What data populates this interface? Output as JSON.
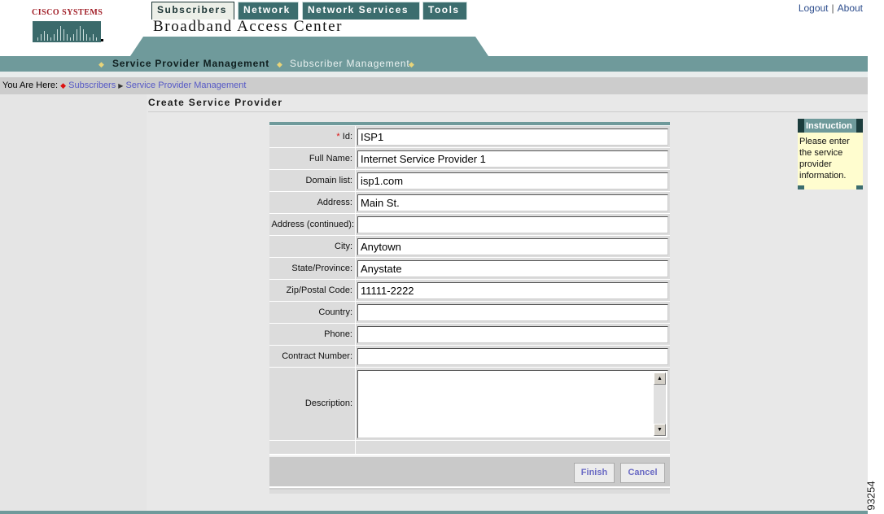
{
  "brand": {
    "logo_text": "Cisco Systems",
    "app_title": "Broadband Access Center"
  },
  "top_links": {
    "logout": "Logout",
    "separator": "|",
    "about": "About"
  },
  "tabs": [
    {
      "label": "Subscribers",
      "active": true
    },
    {
      "label": "Network",
      "active": false
    },
    {
      "label": "Network Services",
      "active": false
    },
    {
      "label": "Tools",
      "active": false
    }
  ],
  "subnav": [
    {
      "label": "Service Provider Management",
      "active": true
    },
    {
      "label": "Subscriber Management",
      "active": false
    }
  ],
  "breadcrumb": {
    "prefix": "You Are Here:",
    "items": [
      "Subscribers",
      "Service Provider Management"
    ]
  },
  "page_title": "Create Service Provider",
  "form": {
    "required_mark": "*",
    "fields": [
      {
        "label": "Id:",
        "value": "ISP1"
      },
      {
        "label": "Full Name:",
        "value": "Internet Service Provider 1"
      },
      {
        "label": "Domain list:",
        "value": "isp1.com"
      },
      {
        "label": "Address:",
        "value": "Main St."
      },
      {
        "label": "Address (continued):",
        "value": ""
      },
      {
        "label": "City:",
        "value": "Anytown"
      },
      {
        "label": "State/Province:",
        "value": "Anystate"
      },
      {
        "label": "Zip/Postal Code:",
        "value": "11111-2222"
      },
      {
        "label": "Country:",
        "value": ""
      },
      {
        "label": "Phone:",
        "value": ""
      },
      {
        "label": "Contract Number:",
        "value": ""
      }
    ],
    "description_label": "Description:",
    "description_value": "",
    "finish_label": "Finish",
    "cancel_label": "Cancel"
  },
  "instruction": {
    "title": "Instruction",
    "text": "Please enter the service provider information."
  },
  "figure_number": "93254",
  "colors": {
    "teal": "#6f9a9b",
    "dark_teal": "#3c6d6e",
    "link": "#5558c6",
    "required": "#dd1111"
  }
}
